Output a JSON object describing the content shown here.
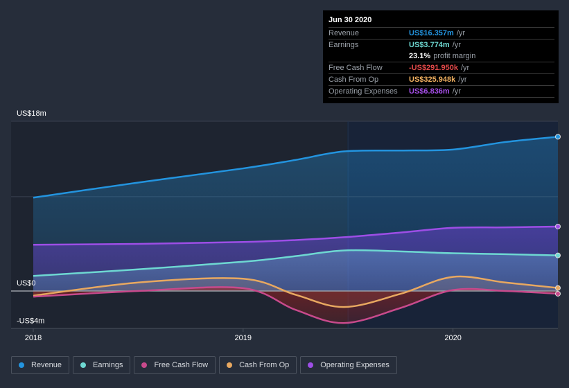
{
  "tooltip": {
    "date": "Jun 30 2020",
    "rows": [
      {
        "label": "Revenue",
        "value": "US$16.357m",
        "unit": "/yr",
        "color": "#2394df"
      },
      {
        "label": "Earnings",
        "value": "US$3.774m",
        "unit": "/yr",
        "color": "#6ed8d2"
      },
      {
        "label": "",
        "value": "23.1%",
        "unit": "profit margin",
        "color": "#ffffff"
      },
      {
        "label": "Free Cash Flow",
        "value": "-US$291.950k",
        "unit": "/yr",
        "color": "#e64a4a"
      },
      {
        "label": "Cash From Op",
        "value": "US$325.948k",
        "unit": "/yr",
        "color": "#f0b060"
      },
      {
        "label": "Operating Expenses",
        "value": "US$6.836m",
        "unit": "/yr",
        "color": "#a44ee6"
      }
    ]
  },
  "legend": [
    {
      "label": "Revenue",
      "color": "#2394df"
    },
    {
      "label": "Earnings",
      "color": "#6ed8d2"
    },
    {
      "label": "Free Cash Flow",
      "color": "#c84a8c"
    },
    {
      "label": "Cash From Op",
      "color": "#e8a860"
    },
    {
      "label": "Operating Expenses",
      "color": "#9d4ee6"
    }
  ],
  "chart_data": {
    "type": "line",
    "title": "",
    "xlabel": "",
    "ylabel": "",
    "x": [
      2018.0,
      2018.5,
      2019.0,
      2019.25,
      2019.48,
      2019.75,
      2020.0,
      2020.25,
      2020.5
    ],
    "x_ticks": [
      {
        "value": 2018,
        "label": "2018"
      },
      {
        "value": 2019,
        "label": "2019"
      },
      {
        "value": 2020,
        "label": "2020"
      }
    ],
    "y_ticks": [
      {
        "value": 18,
        "label": "US$18m"
      },
      {
        "value": 0,
        "label": "US$0"
      },
      {
        "value": -4,
        "label": "-US$4m"
      }
    ],
    "ylim": [
      -4,
      18
    ],
    "xlim": [
      2017.9,
      2020.5
    ],
    "forecast_divider_x": 2019.5,
    "grid": true,
    "legend_position": "bottom",
    "series": [
      {
        "name": "Revenue",
        "color": "#2394df",
        "values": [
          9.9,
          11.5,
          13.0,
          13.9,
          14.8,
          14.9,
          15.0,
          15.8,
          16.357
        ]
      },
      {
        "name": "Operating Expenses",
        "color": "#9d4ee6",
        "values": [
          4.9,
          5.0,
          5.2,
          5.4,
          5.7,
          6.2,
          6.7,
          6.75,
          6.836
        ]
      },
      {
        "name": "Earnings",
        "color": "#6ed8d2",
        "values": [
          1.6,
          2.3,
          3.1,
          3.7,
          4.3,
          4.2,
          4.0,
          3.9,
          3.774
        ]
      },
      {
        "name": "Cash From Op",
        "color": "#e8a860",
        "values": [
          -0.5,
          0.9,
          1.3,
          -0.4,
          -1.7,
          -0.3,
          1.5,
          0.9,
          0.326
        ]
      },
      {
        "name": "Free Cash Flow",
        "color": "#c84a8c",
        "values": [
          -0.6,
          0.0,
          0.3,
          -2.0,
          -3.4,
          -1.8,
          0.1,
          0.0,
          -0.292
        ]
      }
    ]
  }
}
